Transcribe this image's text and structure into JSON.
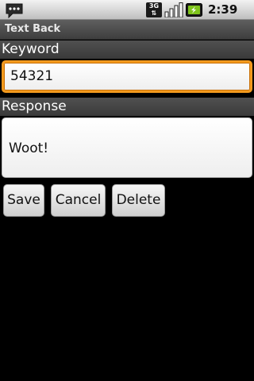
{
  "status_bar": {
    "network_type": "3G",
    "time": "2:39 AM",
    "icons": [
      "sms-notification-icon",
      "network-3g-icon",
      "signal-strength-icon",
      "battery-charging-icon"
    ]
  },
  "app": {
    "title": "Text Back"
  },
  "keyword": {
    "label": "Keyword",
    "value": "54321"
  },
  "response": {
    "label": "Response",
    "value": "Woot!"
  },
  "buttons": {
    "save": "Save",
    "cancel": "Cancel",
    "delete": "Delete"
  },
  "colors": {
    "focus_ring": "#f39a1e",
    "background": "#000000",
    "title_bar": "#4a4a4a"
  }
}
